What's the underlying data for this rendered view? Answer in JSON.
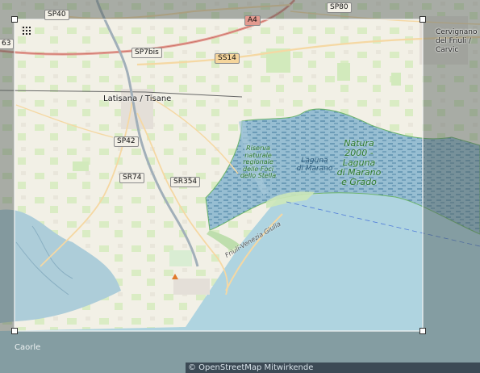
{
  "map": {
    "road_labels": [
      "SP40",
      "SP80",
      "A4",
      "SP7bis",
      "SS14",
      "SP42",
      "SR74",
      "SR354"
    ],
    "edge_label": "63",
    "places": {
      "latisana": "Latisana / Tisane",
      "caorle": "Caorle",
      "cervignano": "Cervignano\ndel Friuli / Carvic"
    },
    "reserve_small": "Riserva\nnaturale\nregionale\ndelle Foci\ndello Stella",
    "reserve_big": "Natura\n2000 -\nLaguna\ndi Marano\ne Grado",
    "lagoon_label": "Laguna\ndi Marano",
    "coastal_road": "Friuli-Venezia Giulia",
    "attribution": "© OpenStreetMap Mitwirkende"
  },
  "selection": {
    "handle_tl": "top-left",
    "handle_tr": "top-right",
    "handle_bl": "bottom-left",
    "handle_br": "bottom-right",
    "grid_icon": "grid-icon"
  },
  "colors": {
    "land": "#f0efe6",
    "farmland": "#ecf3dc",
    "grass": "#cfe9b7",
    "lagoon": "#a7c9d6",
    "sea": "#a9d1de",
    "road_major": "#e39a8f",
    "road_secondary": "#f5d59c",
    "overlay": "#7f8a86",
    "river": "#9aa9b3"
  }
}
